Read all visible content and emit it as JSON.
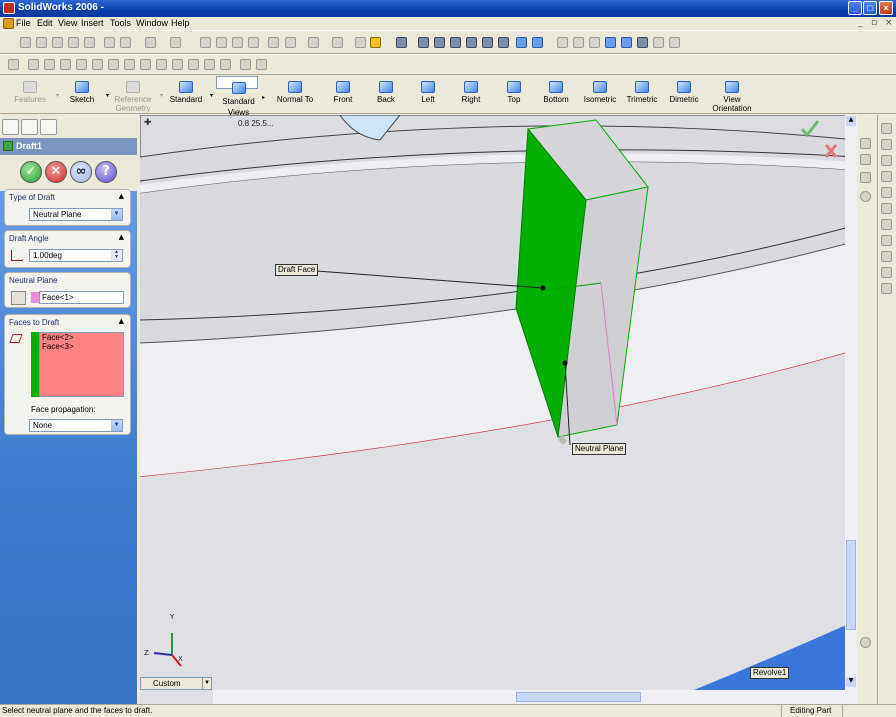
{
  "titlebar": {
    "title": "SolidWorks 2006 -"
  },
  "menu": [
    "File",
    "Edit",
    "View",
    "Insert",
    "Tools",
    "Window",
    "Help"
  ],
  "command_manager": {
    "features_label": "Features",
    "sketch_label": "Sketch",
    "refgeom_label": "Reference Geometry",
    "standard_label": "Standard",
    "standard_views_label": "Standard Views",
    "views": [
      "Normal To",
      "Front",
      "Back",
      "Left",
      "Right",
      "Top",
      "Bottom",
      "Isometric",
      "Trimetric",
      "Dimetric",
      "View Orientation"
    ]
  },
  "property_manager": {
    "title": "Draft1",
    "type_of_draft": {
      "title": "Type of Draft",
      "value": "Neutral Plane"
    },
    "draft_angle": {
      "title": "Draft Angle",
      "value": "1.00deg"
    },
    "neutral_plane": {
      "title": "Neutral Plane",
      "value": "Face<1>"
    },
    "faces_to_draft": {
      "title": "Faces to Draft",
      "items": [
        "Face<2>",
        "Face<3>"
      ]
    },
    "face_propagation": {
      "label": "Face propagation:",
      "value": "None"
    }
  },
  "viewport": {
    "dimension_text": "0.8 25.5...",
    "callouts": {
      "draft_face": "Draft Face",
      "neutral_plane": "Neutral Plane",
      "revolve": "Revolve1"
    },
    "triad_labels": {
      "x": "X",
      "y": "Y",
      "z": "Z"
    },
    "highlight_color": "#00b000"
  },
  "custom_view": "Custom",
  "statusbar": {
    "message": "Select neutral plane and the faces to draft.",
    "mode": "Editing Part"
  }
}
